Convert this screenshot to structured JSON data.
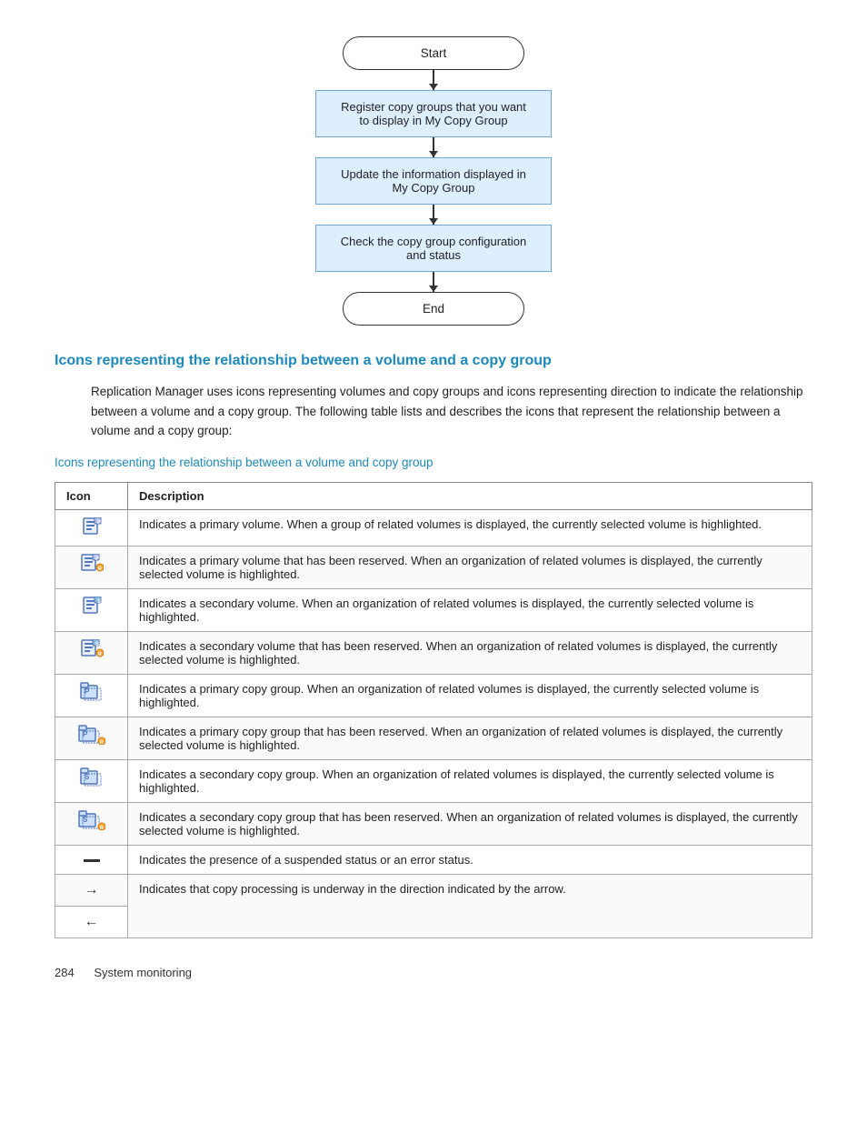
{
  "flowchart": {
    "start_label": "Start",
    "end_label": "End",
    "steps": [
      "Register copy groups that you want to display in My Copy Group",
      "Update the information displayed in My Copy Group",
      "Check the copy group configuration and status"
    ]
  },
  "section": {
    "title": "Icons representing the relationship between a volume and a copy group",
    "body": "Replication Manager uses icons representing volumes and copy groups and icons representing direction to indicate the relationship between a volume and a copy group. The following table lists and describes the icons that represent the relationship between a volume and a copy group:",
    "subsection_link": "Icons representing the relationship between a volume and copy group"
  },
  "table": {
    "headers": [
      "Icon",
      "Description"
    ],
    "rows": [
      {
        "icon": "primary-volume-icon",
        "icon_symbol": "📄",
        "description": "Indicates a primary volume. When a group of related volumes is displayed, the currently selected volume is highlighted."
      },
      {
        "icon": "primary-volume-reserved-icon",
        "icon_symbol": "📄🔖",
        "description": "Indicates a primary volume that has been reserved. When an organization of related volumes is displayed, the currently selected volume is highlighted."
      },
      {
        "icon": "secondary-volume-icon",
        "icon_symbol": "📋",
        "description": "Indicates a secondary volume. When an organization of related volumes is displayed, the currently selected volume is highlighted."
      },
      {
        "icon": "secondary-volume-reserved-icon",
        "icon_symbol": "📋🔖",
        "description": "Indicates a secondary volume that has been reserved. When an organization of related volumes is displayed, the currently selected volume is highlighted."
      },
      {
        "icon": "primary-copy-group-icon",
        "icon_symbol": "🗂️",
        "description": "Indicates a primary copy group. When an organization of related volumes is displayed, the currently selected volume is highlighted."
      },
      {
        "icon": "primary-copy-group-reserved-icon",
        "icon_symbol": "🗂️🔖",
        "description": "Indicates a primary copy group that has been reserved. When an organization of related volumes is displayed, the currently selected volume is highlighted."
      },
      {
        "icon": "secondary-copy-group-icon",
        "icon_symbol": "🗂️",
        "description": "Indicates a secondary copy group. When an organization of related volumes is displayed, the currently selected volume is highlighted."
      },
      {
        "icon": "secondary-copy-group-reserved-icon",
        "icon_symbol": "🗂️🔖",
        "description": "Indicates a secondary copy group that has been reserved. When an organization of related volumes is displayed, the currently selected volume is highlighted."
      },
      {
        "icon": "suspended-error-icon",
        "icon_symbol": "—",
        "description": "Indicates the presence of a suspended status or an error status."
      },
      {
        "icon": "arrow-right-icon",
        "icon_symbol": "→",
        "description": "Indicates that copy processing is underway in the direction indicated by the arrow."
      },
      {
        "icon": "arrow-left-icon",
        "icon_symbol": "←",
        "description": "Indicates that copy processing is underway in the direction indicated by the arrow."
      }
    ]
  },
  "footer": {
    "page_number": "284",
    "section_label": "System monitoring"
  }
}
